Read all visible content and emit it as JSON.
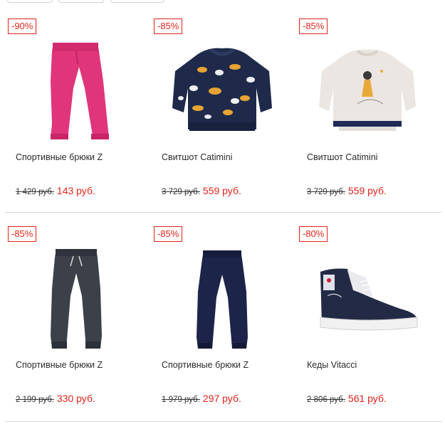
{
  "accent_color": "#e2231a",
  "products": [
    {
      "discount": "-90%",
      "name": "Спортивные брюки Z",
      "old_price": "1 429 руб.",
      "price": "143 руб.",
      "image": "pink-leggings"
    },
    {
      "discount": "-85%",
      "name": "Свитшот Catimini",
      "old_price": "3 729 руб.",
      "price": "559 руб.",
      "image": "navy-cat-sweatshirt"
    },
    {
      "discount": "-85%",
      "name": "Свитшот Catimini",
      "old_price": "3 729 руб.",
      "price": "559 руб.",
      "image": "cream-girl-sweatshirt"
    },
    {
      "discount": "-85%",
      "name": "Спортивные брюки Z",
      "old_price": "2 199 руб.",
      "price": "330 руб.",
      "image": "dark-grey-joggers"
    },
    {
      "discount": "-85%",
      "name": "Спортивные брюки Z",
      "old_price": "1 979 руб.",
      "price": "297 руб.",
      "image": "navy-joggers"
    },
    {
      "discount": "-80%",
      "name": "Кеды Vitacci",
      "old_price": "2 806 руб.",
      "price": "561 руб.",
      "image": "high-top-sneaker"
    }
  ]
}
